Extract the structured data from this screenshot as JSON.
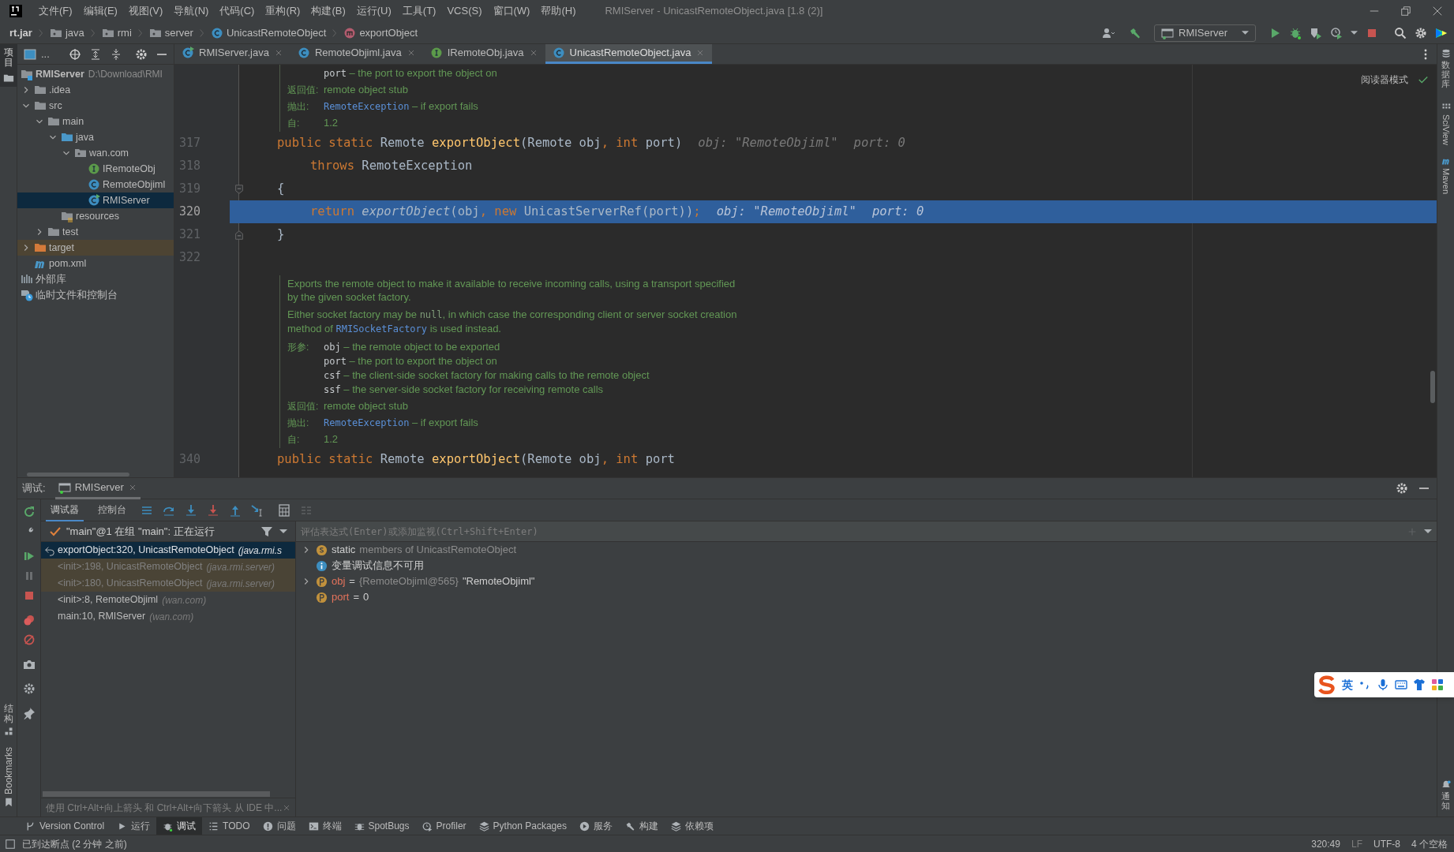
{
  "window": {
    "title": "RMIServer - UnicastRemoteObject.java [1.8 (2)]"
  },
  "menu": [
    "文件(F)",
    "编辑(E)",
    "视图(V)",
    "导航(N)",
    "代码(C)",
    "重构(R)",
    "构建(B)",
    "运行(U)",
    "工具(T)",
    "VCS(S)",
    "窗口(W)",
    "帮助(H)"
  ],
  "breadcrumb": [
    {
      "label": "rt.jar",
      "kind": "jar"
    },
    {
      "label": "java",
      "kind": "package"
    },
    {
      "label": "rmi",
      "kind": "package"
    },
    {
      "label": "server",
      "kind": "package"
    },
    {
      "label": "UnicastRemoteObject",
      "kind": "class"
    },
    {
      "label": "exportObject",
      "kind": "method"
    }
  ],
  "run_config": "RMIServer",
  "left_stripe": {
    "project": "项目",
    "structure": "结构",
    "bookmarks": "Bookmarks"
  },
  "right_stripe": {
    "database": "数据库",
    "sciview": "SciView",
    "maven": "Maven",
    "notifications": "通知"
  },
  "project": {
    "title": "...",
    "tree": [
      {
        "label": "RMIServer",
        "path": "D:\\Download\\RMI",
        "kind": "module",
        "selected": false,
        "children": [
          {
            "label": ".idea",
            "kind": "folder",
            "selected": false,
            "expanded": false
          },
          {
            "label": "src",
            "kind": "folder",
            "selected": false,
            "expanded": true,
            "children": [
              {
                "label": "main",
                "kind": "folder",
                "selected": false,
                "expanded": true,
                "children": [
                  {
                    "label": "java",
                    "kind": "source",
                    "selected": false,
                    "expanded": true,
                    "children": [
                      {
                        "label": "wan.com",
                        "kind": "package",
                        "selected": false,
                        "expanded": true,
                        "children": [
                          {
                            "label": "IRemoteObj",
                            "kind": "interface",
                            "selected": false
                          },
                          {
                            "label": "RemoteObjiml",
                            "kind": "class",
                            "selected": false
                          },
                          {
                            "label": "RMIServer",
                            "kind": "class-run",
                            "selected": true
                          }
                        ]
                      }
                    ]
                  },
                  {
                    "label": "resources",
                    "kind": "resources",
                    "selected": false
                  }
                ]
              },
              {
                "label": "test",
                "kind": "folder",
                "selected": false,
                "expanded": false
              }
            ]
          },
          {
            "label": "target",
            "kind": "excluded",
            "selected": false,
            "expanded": false
          },
          {
            "label": "pom.xml",
            "kind": "maven",
            "selected": false
          }
        ]
      },
      {
        "label": "外部库",
        "kind": "library",
        "selected": false
      },
      {
        "label": "临时文件和控制台",
        "kind": "scratch",
        "selected": false
      }
    ]
  },
  "editor": {
    "tabs": [
      {
        "label": "RMIServer.java",
        "kind": "class-run",
        "selected": false
      },
      {
        "label": "RemoteObjiml.java",
        "kind": "class",
        "selected": false
      },
      {
        "label": "IRemoteObj.java",
        "kind": "interface",
        "selected": false
      },
      {
        "label": "UnicastRemoteObject.java",
        "kind": "class",
        "selected": true
      }
    ],
    "reader_mode": "阅读器模式",
    "blocks": [
      {
        "kind": "doc",
        "tags": [
          {
            "lines": [
              [
                {
                  "t": "port",
                  "kind": "param"
                },
                {
                  "t": " – the port to export the object on",
                  "kind": "text"
                }
              ]
            ]
          },
          {
            "label": "返回值:",
            "lines": [
              [
                {
                  "t": "remote object stub",
                  "kind": "text"
                }
              ]
            ]
          },
          {
            "label": "抛出:",
            "lines": [
              [
                {
                  "t": "RemoteException",
                  "kind": "link"
                },
                {
                  "t": " – if export fails",
                  "kind": "text"
                }
              ]
            ]
          },
          {
            "label": "自:",
            "lines": [
              [
                {
                  "t": "1.2",
                  "kind": "text"
                }
              ]
            ]
          }
        ]
      },
      {
        "kind": "code",
        "number": "317",
        "current": false,
        "tokens": [
          {
            "t": "public static ",
            "kind": "kw"
          },
          {
            "t": "Remote ",
            "kind": "plain"
          },
          {
            "t": "exportObject",
            "kind": "fn"
          },
          {
            "t": "(Remote obj",
            "kind": "plain"
          },
          {
            "t": ", int ",
            "kind": "kw"
          },
          {
            "t": "port)",
            "kind": "plain"
          },
          {
            "t": "obj: \"RemoteObjiml\"",
            "kind": "hint"
          },
          {
            "t": "port: 0",
            "kind": "hint"
          }
        ]
      },
      {
        "kind": "code",
        "number": "318",
        "current": false,
        "indent": true,
        "tokens": [
          {
            "t": "throws ",
            "kind": "kw"
          },
          {
            "t": "RemoteException",
            "kind": "plain"
          }
        ]
      },
      {
        "kind": "code",
        "number": "319",
        "current": false,
        "fold": {
          "kind": "start"
        },
        "tokens": [
          {
            "t": "{",
            "kind": "plain"
          }
        ]
      },
      {
        "kind": "code",
        "number": "320",
        "current": true,
        "indent": true,
        "tokens": [
          {
            "t": "return ",
            "kind": "kw"
          },
          {
            "t": "exportObject",
            "kind": "ital"
          },
          {
            "t": "(obj",
            "kind": "plain"
          },
          {
            "t": ", new ",
            "kind": "kw"
          },
          {
            "t": "UnicastServerRef(port))",
            "kind": "plain"
          },
          {
            "t": ";",
            "kind": "kw"
          },
          {
            "t": "obj: \"RemoteObjiml\"",
            "kind": "hint"
          },
          {
            "t": "port: 0",
            "kind": "hint"
          }
        ]
      },
      {
        "kind": "code",
        "number": "321",
        "current": false,
        "fold": {
          "kind": "end"
        },
        "tokens": [
          {
            "t": "}",
            "kind": "plain"
          }
        ]
      },
      {
        "kind": "code",
        "number": "322",
        "current": false
      },
      {
        "kind": "doc",
        "paragraphs": [
          [
            [
              {
                "t": "Exports the remote object to make it available to receive incoming calls, using a transport specified",
                "kind": "text"
              }
            ],
            [
              {
                "t": "by the given socket factory.",
                "kind": "text"
              }
            ]
          ],
          [
            [
              {
                "t": "Either socket factory may be ",
                "kind": "text"
              },
              {
                "t": "null",
                "kind": "code"
              },
              {
                "t": ", in which case the corresponding client or server socket creation",
                "kind": "text"
              }
            ],
            [
              {
                "t": "method of ",
                "kind": "text"
              },
              {
                "t": "RMISocketFactory",
                "kind": "link"
              },
              {
                "t": " is used instead.",
                "kind": "text"
              }
            ]
          ]
        ],
        "tags": [
          {
            "label": "形参:",
            "lines": [
              [
                {
                  "t": "obj",
                  "kind": "param"
                },
                {
                  "t": " – the remote object to be exported",
                  "kind": "text"
                }
              ],
              [
                {
                  "t": "port",
                  "kind": "param"
                },
                {
                  "t": " – the port to export the object on",
                  "kind": "text"
                }
              ],
              [
                {
                  "t": "csf",
                  "kind": "param"
                },
                {
                  "t": " – the client-side socket factory for making calls to the remote object",
                  "kind": "text"
                }
              ],
              [
                {
                  "t": "ssf",
                  "kind": "param"
                },
                {
                  "t": " – the server-side socket factory for receiving remote calls",
                  "kind": "text"
                }
              ]
            ]
          },
          {
            "label": "返回值:",
            "lines": [
              [
                {
                  "t": "remote object stub",
                  "kind": "text"
                }
              ]
            ]
          },
          {
            "label": "抛出:",
            "lines": [
              [
                {
                  "t": "RemoteException",
                  "kind": "link"
                },
                {
                  "t": " – if export fails",
                  "kind": "text"
                }
              ]
            ]
          },
          {
            "label": "自:",
            "lines": [
              [
                {
                  "t": "1.2",
                  "kind": "text"
                }
              ]
            ]
          }
        ]
      },
      {
        "kind": "code",
        "number": "340",
        "current": false,
        "tokens": [
          {
            "t": "public static ",
            "kind": "kw"
          },
          {
            "t": "Remote ",
            "kind": "plain"
          },
          {
            "t": "exportObject",
            "kind": "fn"
          },
          {
            "t": "(Remote obj",
            "kind": "plain"
          },
          {
            "t": ", int ",
            "kind": "kw"
          },
          {
            "t": "port",
            "kind": "plain"
          }
        ]
      }
    ]
  },
  "debug": {
    "label": "调试:",
    "session": "RMIServer",
    "subtabs": [
      {
        "label": "调试器",
        "selected": true
      },
      {
        "label": "控制台",
        "selected": false
      }
    ],
    "thread": "\"main\"@1 在组 \"main\": 正在运行",
    "frames": [
      {
        "name": "exportObject:320, UnicastRemoteObject",
        "loc": "(java.rmi.s",
        "kind": "current",
        "selected": true
      },
      {
        "name": "<init>:198, UnicastRemoteObject",
        "loc": "(java.rmi.server)",
        "kind": "library",
        "selected": false
      },
      {
        "name": "<init>:180, UnicastRemoteObject",
        "loc": "(java.rmi.server)",
        "kind": "library",
        "selected": false
      },
      {
        "name": "<init>:8, RemoteObjiml",
        "loc": "(wan.com)",
        "kind": "normal",
        "selected": false
      },
      {
        "name": "main:10, RMIServer",
        "loc": "(wan.com)",
        "kind": "normal",
        "selected": false
      }
    ],
    "hint": "使用 Ctrl+Alt+向上箭头 和 Ctrl+Alt+向下箭头 从 IDE 中...",
    "evaluate": {
      "placeholder": "评估表达式(Enter)或添加监视(Ctrl+Shift+Enter)"
    },
    "variables": [
      {
        "kind": "static",
        "name": "static",
        "detail": "members of UnicastRemoteObject",
        "expandable": true
      },
      {
        "kind": "info",
        "name": "变量调试信息不可用",
        "expandable": false
      },
      {
        "kind": "field",
        "name": "obj",
        "sep": "=",
        "type": "{RemoteObjiml@565}",
        "value": "\"RemoteObjiml\"",
        "expandable": true
      },
      {
        "kind": "field",
        "name": "port",
        "sep": "=",
        "value": "0",
        "expandable": false
      }
    ]
  },
  "tool_tabs": [
    {
      "label": "Version Control",
      "selected": false
    },
    {
      "label": "运行",
      "selected": false
    },
    {
      "label": "调试",
      "selected": true
    },
    {
      "label": "TODO",
      "selected": false
    },
    {
      "label": "问题",
      "selected": false
    },
    {
      "label": "终端",
      "selected": false
    },
    {
      "label": "SpotBugs",
      "selected": false
    },
    {
      "label": "Profiler",
      "selected": false
    },
    {
      "label": "Python Packages",
      "selected": false
    },
    {
      "label": "服务",
      "selected": false
    },
    {
      "label": "构建",
      "selected": false
    },
    {
      "label": "依赖项",
      "selected": false
    }
  ],
  "status_bar": {
    "message": "已到达断点 (2 分钟 之前)",
    "position": "320:49",
    "line_separator": "LF",
    "encoding": "UTF-8",
    "indent": "4 个空格"
  },
  "ime": {
    "mode": "英"
  }
}
